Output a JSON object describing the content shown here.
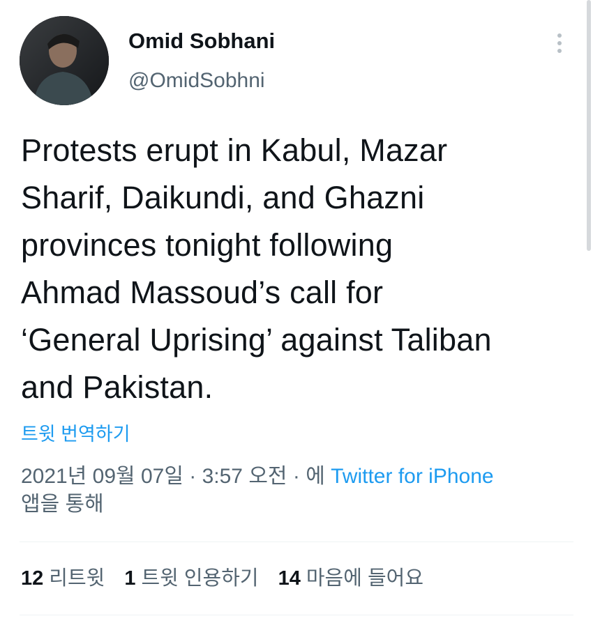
{
  "author": {
    "display_name": "Omid Sobhani",
    "handle": "@OmidSobhni"
  },
  "tweet": {
    "text": "Protests erupt in Kabul, Mazar\nSharif, Daikundi, and Ghazni\nprovinces tonight following\nAhmad Massoud’s call for\n‘General Uprising’ against Taliban\nand Pakistan.",
    "translate_label": "트윗 번역하기"
  },
  "meta": {
    "timestamp": "2021년 09월 07일 · 3:57 오전 · 에 ",
    "source": "Twitter for iPhone",
    "source_suffix": "\n앱을 통해"
  },
  "stats": {
    "retweets_count": "12",
    "retweets_label": "리트윗",
    "quotes_count": "1",
    "quotes_label": "트윗 인용하기",
    "likes_count": "14",
    "likes_label": "마음에 들어요"
  },
  "icons": {
    "more": "more-vertical-icon"
  }
}
